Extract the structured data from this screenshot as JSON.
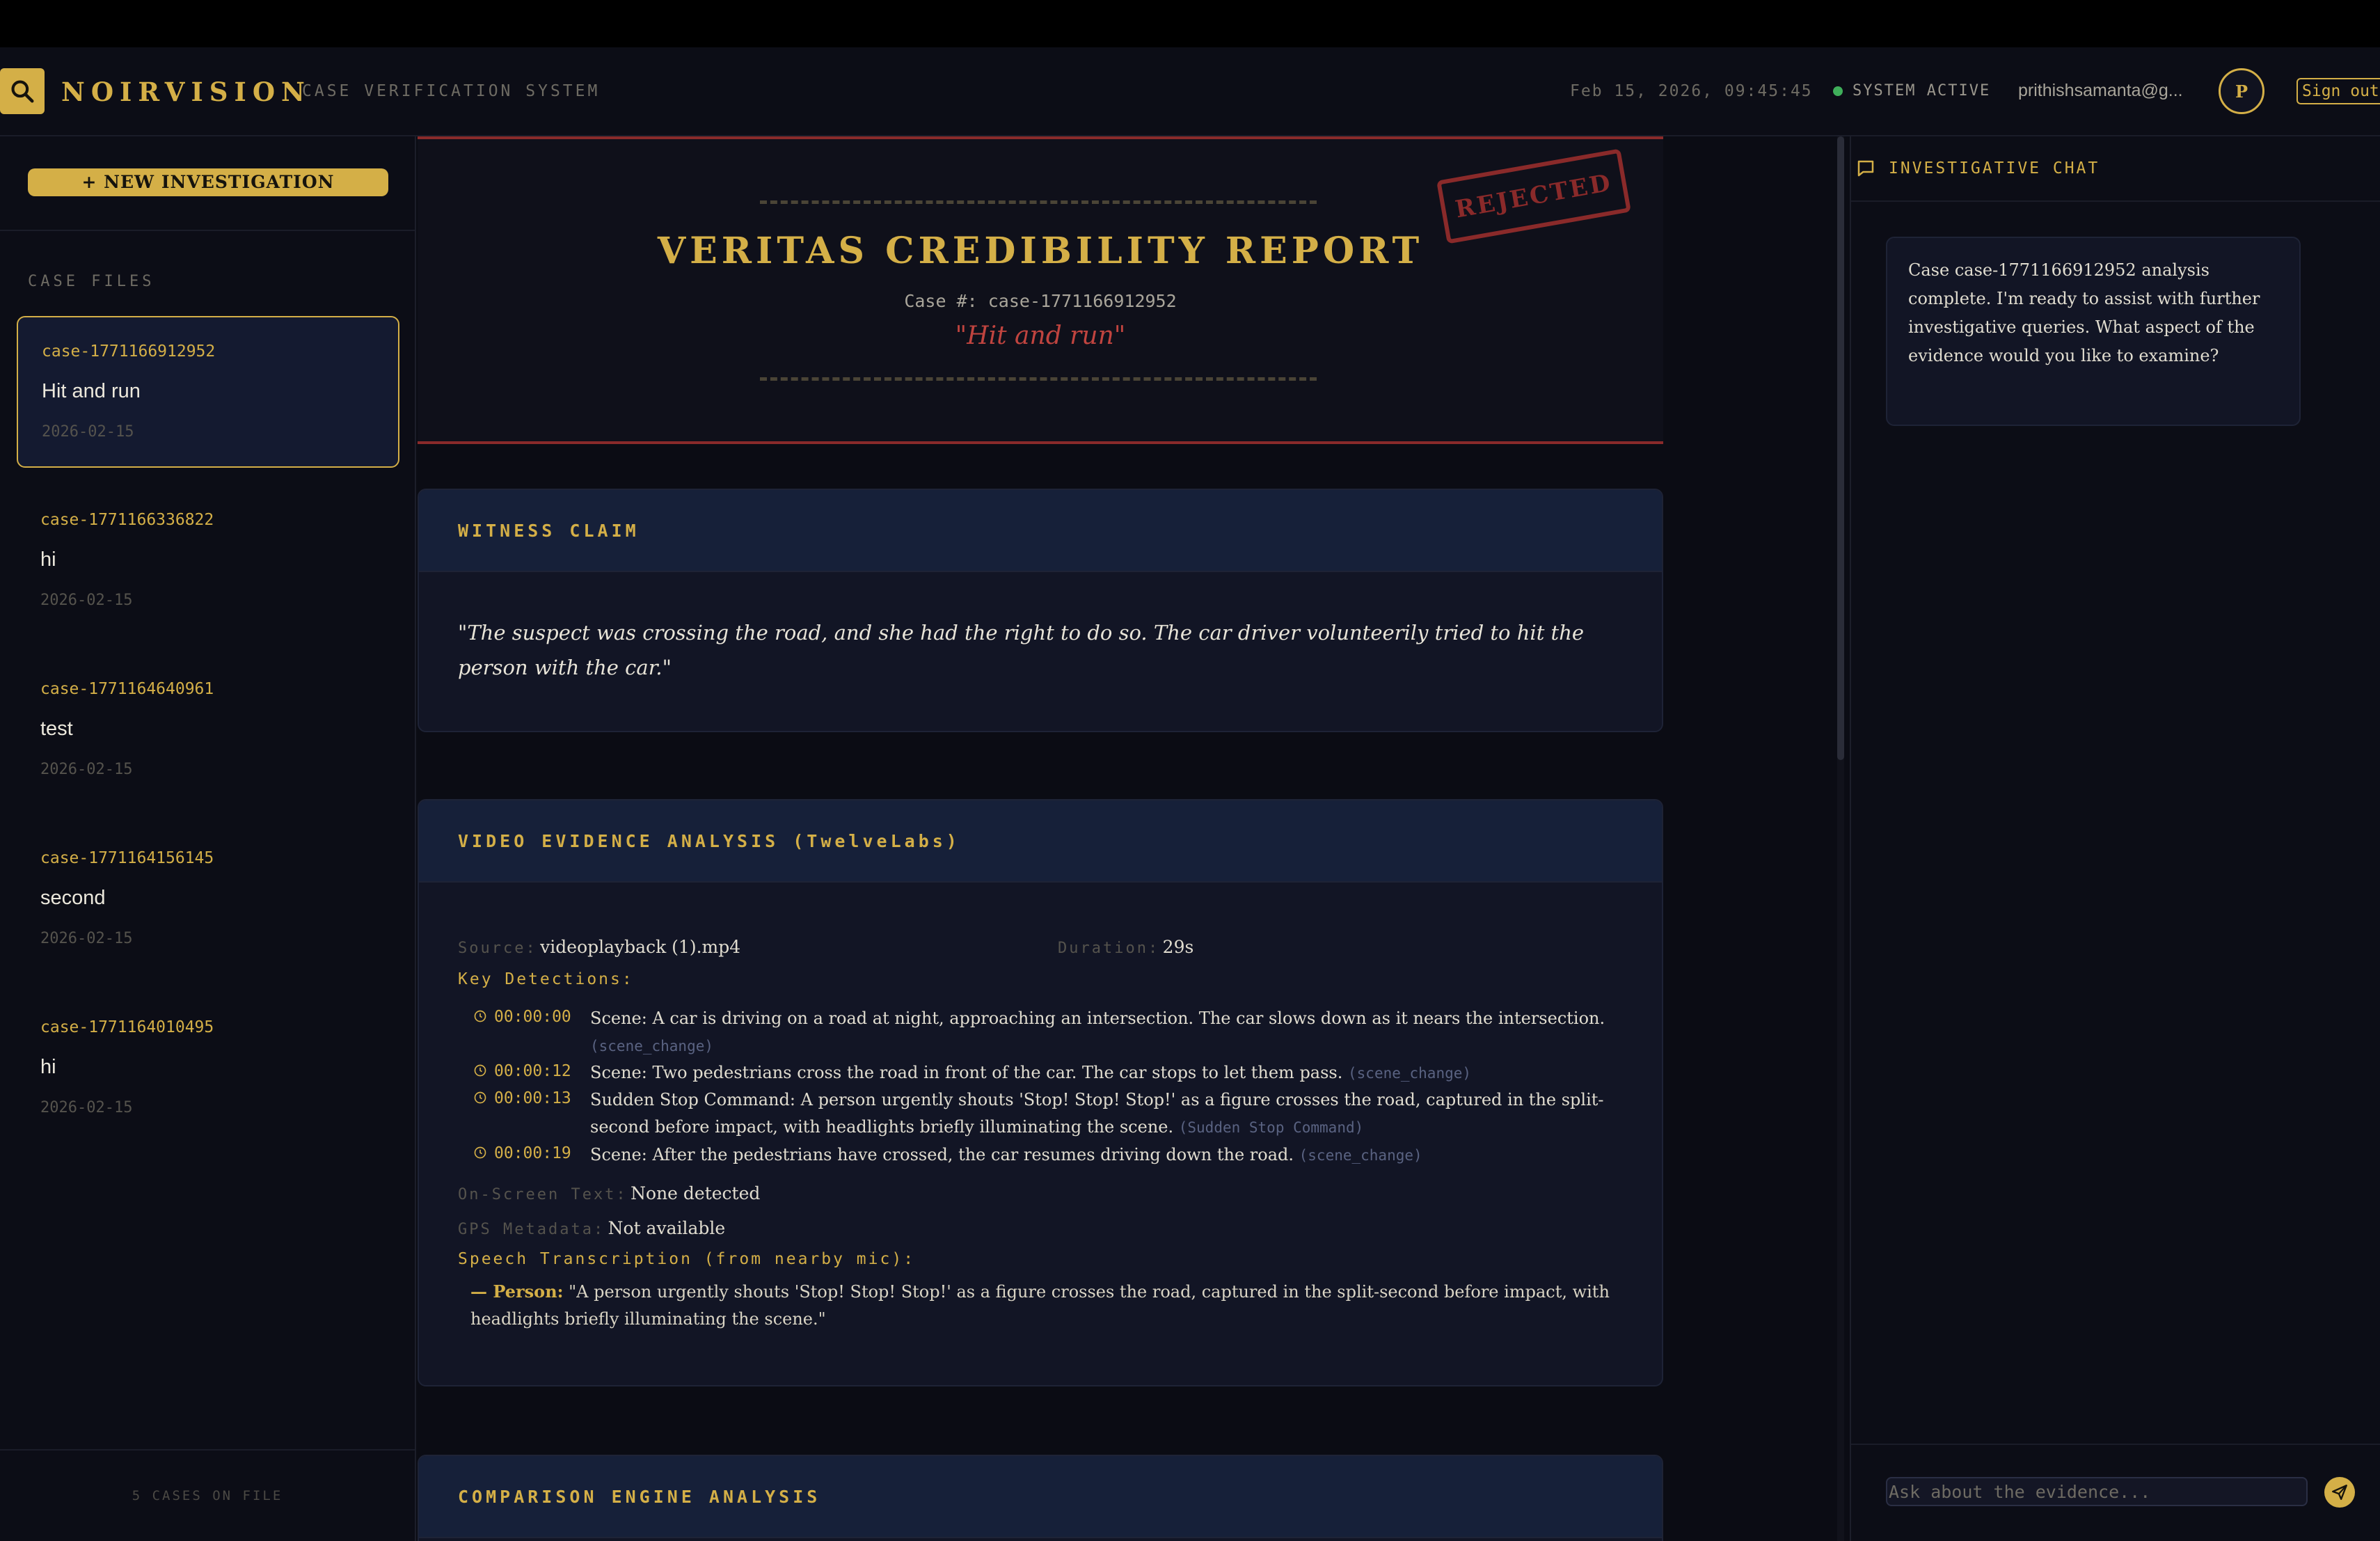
{
  "header": {
    "brand": "NOIRVISION",
    "subtitle": "CASE VERIFICATION SYSTEM",
    "datetime": "Feb 15, 2026, 09:45:45",
    "status": "SYSTEM ACTIVE",
    "email": "prithishsamanta@g...",
    "avatar_initial": "P",
    "sign_out": "Sign out",
    "accent_color": "#d4af47",
    "status_color": "#3fae5a"
  },
  "sidebar": {
    "new_button": "+  NEW INVESTIGATION",
    "section_label": "CASE FILES",
    "cases": [
      {
        "id": "case-1771166912952",
        "title": "Hit and run",
        "date": "2026-02-15",
        "active": true
      },
      {
        "id": "case-1771166336822",
        "title": "hi",
        "date": "2026-02-15",
        "active": false
      },
      {
        "id": "case-1771164640961",
        "title": "test",
        "date": "2026-02-15",
        "active": false
      },
      {
        "id": "case-1771164156145",
        "title": "second",
        "date": "2026-02-15",
        "active": false
      },
      {
        "id": "case-1771164010495",
        "title": "hi",
        "date": "2026-02-15",
        "active": false
      }
    ],
    "footer": "5 CASES ON FILE"
  },
  "report": {
    "title": "VERITAS CREDIBILITY REPORT",
    "case_number": "Case #: case-1771166912952",
    "case_quote": "\"Hit and run\"",
    "stamp": "REJECTED",
    "stamp_color": "#8a2a2a"
  },
  "witness": {
    "heading": "WITNESS CLAIM",
    "text": "\"The suspect was crossing the road, and she had the right to do so. The car driver volunteerily tried to hit the person with the car.\""
  },
  "video": {
    "heading": "VIDEO EVIDENCE ANALYSIS (TwelveLabs)",
    "source_label": "Source:",
    "source_value": "videoplayback (1).mp4",
    "duration_label": "Duration:",
    "duration_value": "29s",
    "detections_label": "Key Detections:",
    "detections": [
      {
        "time": "00:00:00",
        "text": "Scene: A car is driving on a road at night, approaching an intersection. The car slows down as it nears the intersection.",
        "tag": "(scene_change)"
      },
      {
        "time": "00:00:12",
        "text": "Scene: Two pedestrians cross the road in front of the car. The car stops to let them pass.",
        "tag": "(scene_change)"
      },
      {
        "time": "00:00:13",
        "text": "Sudden Stop Command: A person urgently shouts 'Stop! Stop! Stop!' as a figure crosses the road, captured in the split-second before impact, with headlights briefly illuminating the scene.",
        "tag": "(Sudden Stop Command)"
      },
      {
        "time": "00:00:19",
        "text": "Scene: After the pedestrians have crossed, the car resumes driving down the road.",
        "tag": "(scene_change)"
      }
    ],
    "ocr_label": "On-Screen Text:",
    "ocr_value": "None detected",
    "gps_label": "GPS Metadata:",
    "gps_value": "Not available",
    "speech_label": "Speech Transcription (from nearby mic):",
    "speech_prefix": "— Person:",
    "speech_text": " \"A person urgently shouts 'Stop! Stop! Stop!' as a figure crosses the road, captured in the split-second before impact, with headlights briefly illuminating the scene.\""
  },
  "comparison": {
    "heading": "COMPARISON ENGINE ANALYSIS"
  },
  "chat": {
    "heading": "INVESTIGATIVE CHAT",
    "message": "Case case-1771166912952 analysis complete. I'm ready to assist with further investigative queries. What aspect of the evidence would you like to examine?",
    "input_placeholder": "Ask about the evidence..."
  }
}
